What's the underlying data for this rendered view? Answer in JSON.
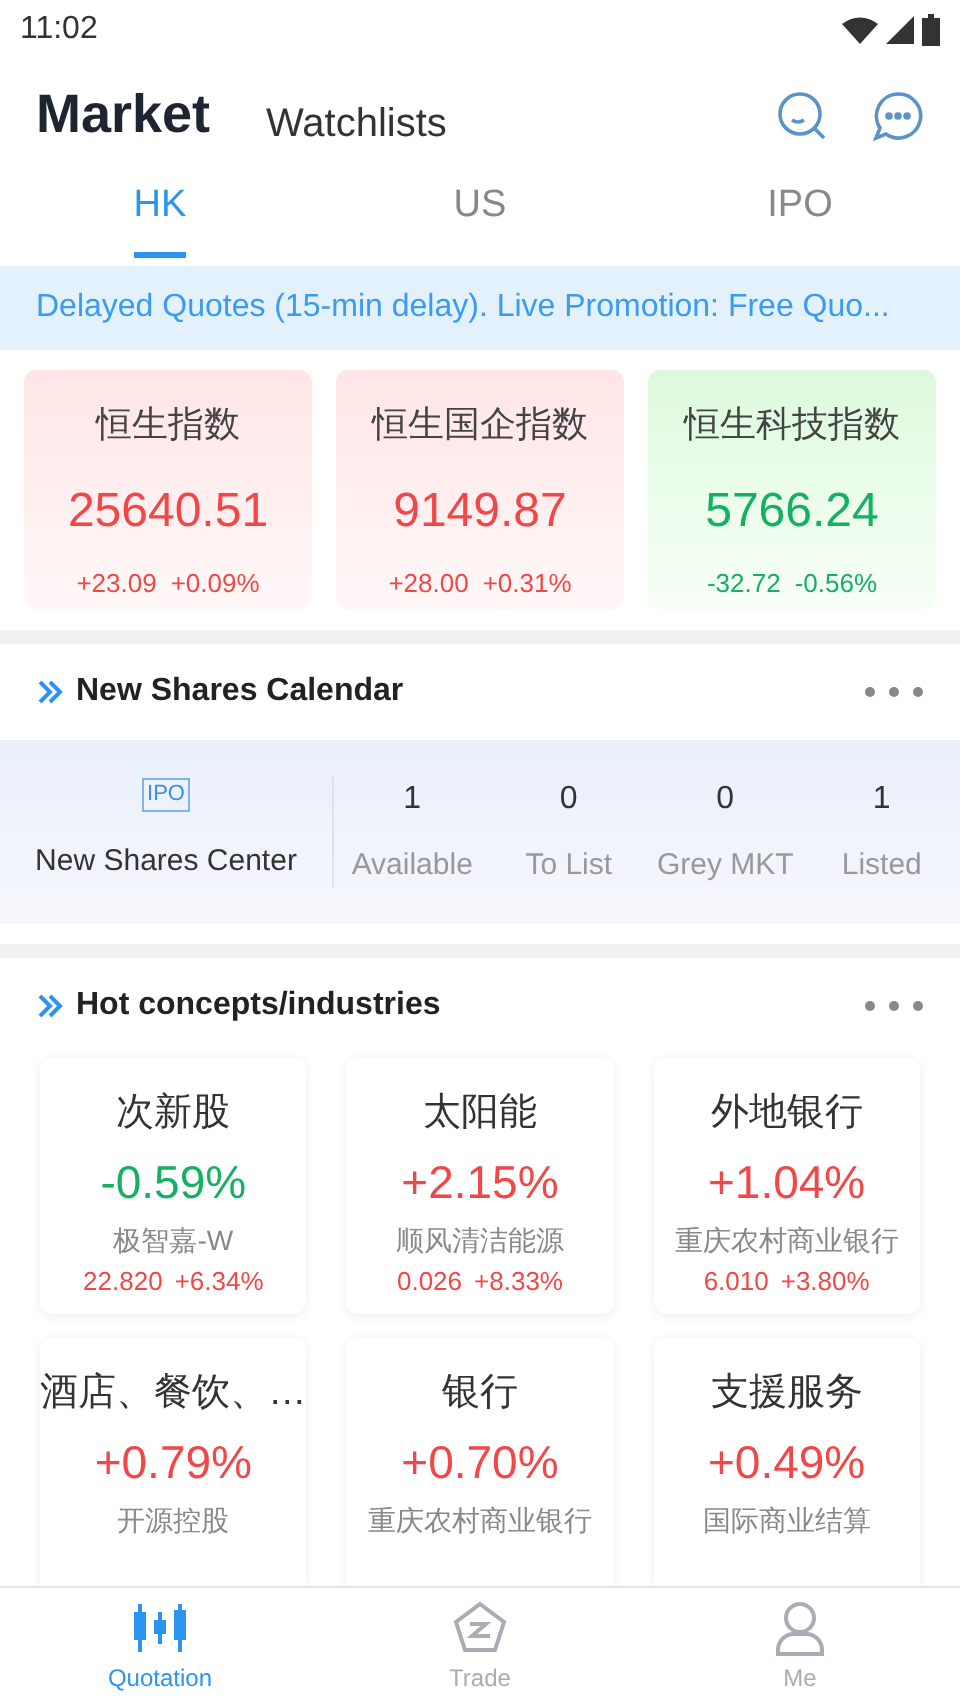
{
  "status_bar": {
    "time": "11:02"
  },
  "header": {
    "tabs": [
      {
        "label": "Market",
        "selected": true
      },
      {
        "label": "Watchlists",
        "selected": false
      }
    ]
  },
  "market_tabs": [
    {
      "label": "HK",
      "selected": true
    },
    {
      "label": "US",
      "selected": false
    },
    {
      "label": "IPO",
      "selected": false
    }
  ],
  "banner": "Delayed Quotes (15-min delay). Live Promotion: Free Quo...",
  "indices": [
    {
      "name": "恒生指数",
      "value": "25640.51",
      "change": "+23.09",
      "percent": "+0.09%",
      "kind": "up"
    },
    {
      "name": "恒生国企指数",
      "value": "9149.87",
      "change": "+28.00",
      "percent": "+0.31%",
      "kind": "up"
    },
    {
      "name": "恒生科技指数",
      "value": "5766.24",
      "change": "-32.72",
      "percent": "-0.56%",
      "kind": "down"
    }
  ],
  "new_shares": {
    "title": "New Shares Calendar",
    "center": {
      "badge": "IPO",
      "label": "New Shares Center"
    },
    "stats": [
      {
        "count": "1",
        "label": "Available"
      },
      {
        "count": "0",
        "label": "To List"
      },
      {
        "count": "0",
        "label": "Grey MKT"
      },
      {
        "count": "1",
        "label": "Listed"
      }
    ]
  },
  "hot": {
    "title": "Hot concepts/industries",
    "items": [
      {
        "name": "次新股",
        "percent": "-0.59%",
        "kind": "down",
        "stock": {
          "name": "极智嘉-W",
          "price": "22.820",
          "percent": "+6.34%",
          "kind": "up"
        }
      },
      {
        "name": "太阳能",
        "percent": "+2.15%",
        "kind": "up",
        "stock": {
          "name": "顺风清洁能源",
          "price": "0.026",
          "percent": "+8.33%",
          "kind": "up"
        }
      },
      {
        "name": "外地银行",
        "percent": "+1.04%",
        "kind": "up",
        "stock": {
          "name": "重庆农村商业银行",
          "price": "6.010",
          "percent": "+3.80%",
          "kind": "up"
        }
      },
      {
        "name": "酒店、餐饮、…",
        "percent": "+0.79%",
        "kind": "up",
        "stock": {
          "name": "开源控股"
        }
      },
      {
        "name": "银行",
        "percent": "+0.70%",
        "kind": "up",
        "stock": {
          "name": "重庆农村商业银行"
        }
      },
      {
        "name": "支援服务",
        "percent": "+0.49%",
        "kind": "up",
        "stock": {
          "name": "国际商业结算"
        }
      }
    ]
  },
  "bottom_nav": [
    {
      "label": "Quotation",
      "selected": true,
      "kind": "candles"
    },
    {
      "label": "Trade",
      "selected": false,
      "kind": "trade"
    },
    {
      "label": "Me",
      "selected": false,
      "kind": "person"
    }
  ]
}
